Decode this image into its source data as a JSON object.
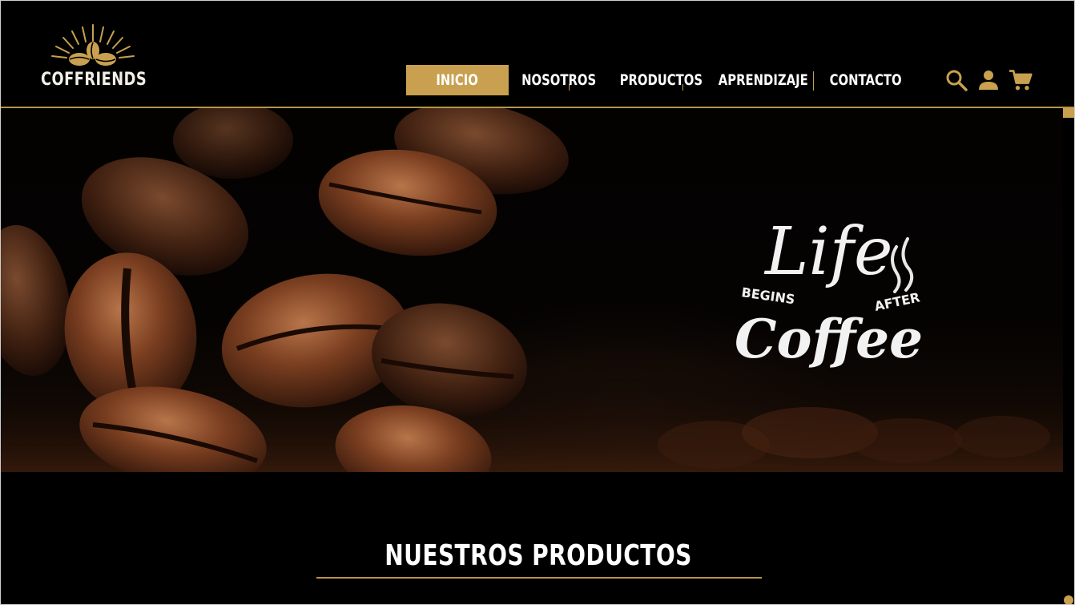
{
  "brand": {
    "name": "COFFRIENDS"
  },
  "nav": {
    "items": [
      {
        "label": "INICIO"
      },
      {
        "label": "NOSOTROS"
      },
      {
        "label": "PRODUCTOS"
      },
      {
        "label": "APRENDIZAJE"
      },
      {
        "label": "CONTACTO"
      }
    ],
    "active_index": 0
  },
  "header_icons": [
    "search-icon",
    "user-icon",
    "cart-icon"
  ],
  "hero": {
    "line1": "Life",
    "line2": "BEGINS",
    "line3": "AFTER",
    "line4": "Coffee"
  },
  "section": {
    "title": "NUESTROS PRODUCTOS"
  },
  "colors": {
    "accent": "#c8a04f",
    "background": "#000000",
    "text": "#ffffff"
  }
}
